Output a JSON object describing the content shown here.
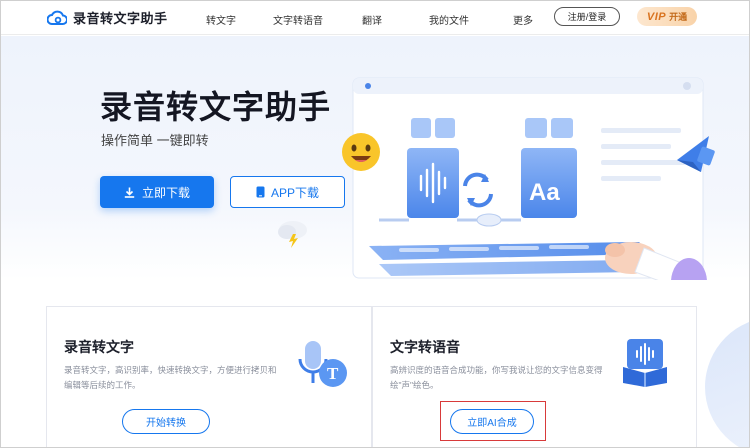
{
  "header": {
    "brand": "录音转文字助手",
    "nav": [
      "转文字",
      "文字转语音",
      "翻译",
      "我的文件",
      "更多"
    ],
    "login_label": "注册/登录",
    "vip_label": "VIP",
    "vip_action": "开通"
  },
  "hero": {
    "title": "录音转文字助手",
    "subtitle": "操作简单 一键即转",
    "download_label": "立即下载",
    "app_label": "APP下载"
  },
  "cards": [
    {
      "title": "录音转文字",
      "desc": "录音转文字，高识别率，快速转换文字，方便进行拷贝和编辑等后续的工作。",
      "button": "开始转换"
    },
    {
      "title": "文字转语音",
      "desc": "高辨识度的语音合成功能，你写我说让您的文字信息变得绘\"声\"绘色。",
      "button": "立即AI合成"
    }
  ],
  "colors": {
    "accent": "#1677ee",
    "highlight": "#d83a3a",
    "vip": "#d9731f"
  }
}
